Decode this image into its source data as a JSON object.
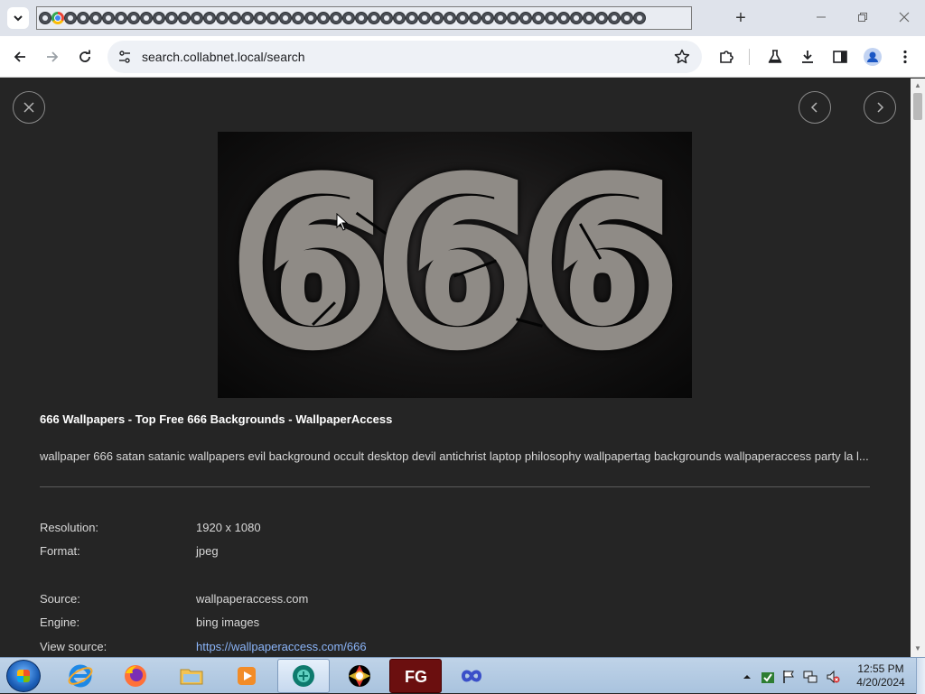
{
  "browser": {
    "url": "search.collabnet.local/search",
    "tab_count_visual": 48
  },
  "viewer": {
    "image_text": "666",
    "title": "666 Wallpapers - Top Free 666 Backgrounds - WallpaperAccess",
    "description": "wallpaper 666 satan satanic wallpapers evil background occult desktop devil antichrist laptop philosophy wallpapertag backgrounds wallpaperaccess party la l...",
    "meta": [
      {
        "label": "Resolution:",
        "value": "1920 x 1080"
      },
      {
        "label": "Format:",
        "value": "jpeg"
      },
      {
        "label": "Source:",
        "value": "wallpaperaccess.com"
      },
      {
        "label": "Engine:",
        "value": "bing images"
      },
      {
        "label": "View source:",
        "value": "https://wallpaperaccess.com/666"
      }
    ]
  },
  "taskbar": {
    "time": "12:55 PM",
    "date": "4/20/2024",
    "apps": [
      "internet-explorer",
      "firefox",
      "file-explorer",
      "media-player",
      "browser-active",
      "photo-app",
      "filezilla",
      "infinity-app"
    ]
  },
  "colors": {
    "viewer_bg": "#252525",
    "link": "#8ab4f8",
    "chrome_bg": "#dfe3eb"
  }
}
